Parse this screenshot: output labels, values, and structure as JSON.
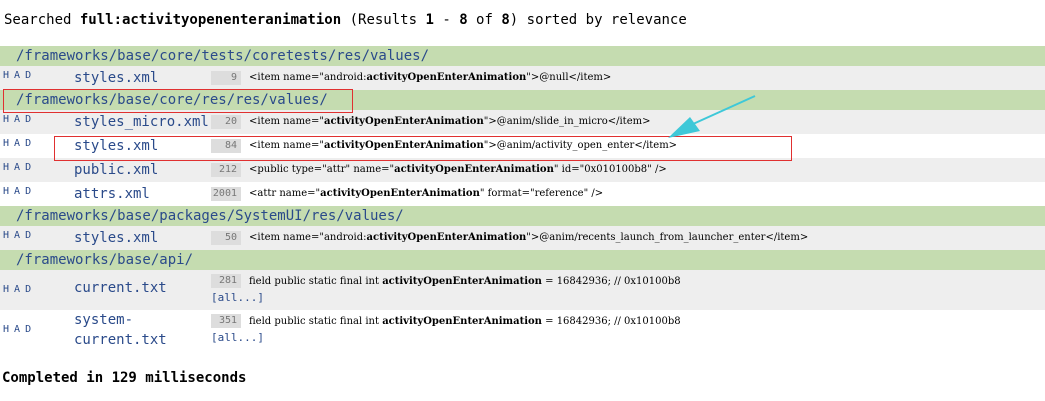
{
  "summary": {
    "prefix": "Searched ",
    "query": "full:activityopenenteranimation",
    "middle": " (Results ",
    "range_start": "1",
    "range_sep": " - ",
    "range_end": "8",
    "of": " of ",
    "total": "8",
    "suffix": ") sorted by relevance"
  },
  "had": [
    "H",
    "A",
    "D"
  ],
  "sections": [
    {
      "dir": "/frameworks/base/core/tests/coretests/res/values/",
      "files": [
        {
          "name": "styles.xml",
          "line": "9",
          "pre": "<item name=\"android:",
          "hl": "activityOpenEnterAnimation",
          "post": "\">@null</item>"
        }
      ]
    },
    {
      "dir": "/frameworks/base/core/res/res/values/",
      "files": [
        {
          "name": "styles_micro.xml",
          "line": "20",
          "pre": "<item name=\"",
          "hl": "activityOpenEnterAnimation",
          "post": "\">@anim/slide_in_micro</item>"
        },
        {
          "name": "styles.xml",
          "line": "84",
          "pre": "<item name=\"",
          "hl": "activityOpenEnterAnimation",
          "post": "\">@anim/activity_open_enter</item>"
        },
        {
          "name": "public.xml",
          "line": "212",
          "pre": "<public type=\"attr\" name=\"",
          "hl": "activityOpenEnterAnimation",
          "post": "\" id=\"0x010100b8\" />"
        },
        {
          "name": "attrs.xml",
          "line": "2001",
          "pre": "<attr name=\"",
          "hl": "activityOpenEnterAnimation",
          "post": "\" format=\"reference\" />"
        }
      ]
    },
    {
      "dir": "/frameworks/base/packages/SystemUI/res/values/",
      "files": [
        {
          "name": "styles.xml",
          "line": "50",
          "pre": "<item name=\"android:",
          "hl": "activityOpenEnterAnimation",
          "post": "\">@anim/recents_launch_from_launcher_enter</item>"
        }
      ]
    },
    {
      "dir": "/frameworks/base/api/",
      "files": [
        {
          "name": "current.txt",
          "line": "281",
          "pre": "field public static final int ",
          "hl": "activityOpenEnterAnimation",
          "post": " = 16842936; // 0x10100b8",
          "more": "[all...]"
        },
        {
          "name_lines": [
            "system-",
            "current.txt"
          ],
          "line": "351",
          "pre": "field public static final int ",
          "hl": "activityOpenEnterAnimation",
          "post": " = 16842936; // 0x10100b8",
          "more": "[all...]"
        }
      ]
    }
  ],
  "footer": "Completed in 129 milliseconds",
  "colors": {
    "dir_bg": "#c5dcb0",
    "link": "#2a4a8a",
    "highlight_box": "#e03030",
    "arrow": "#3ec8d8"
  }
}
